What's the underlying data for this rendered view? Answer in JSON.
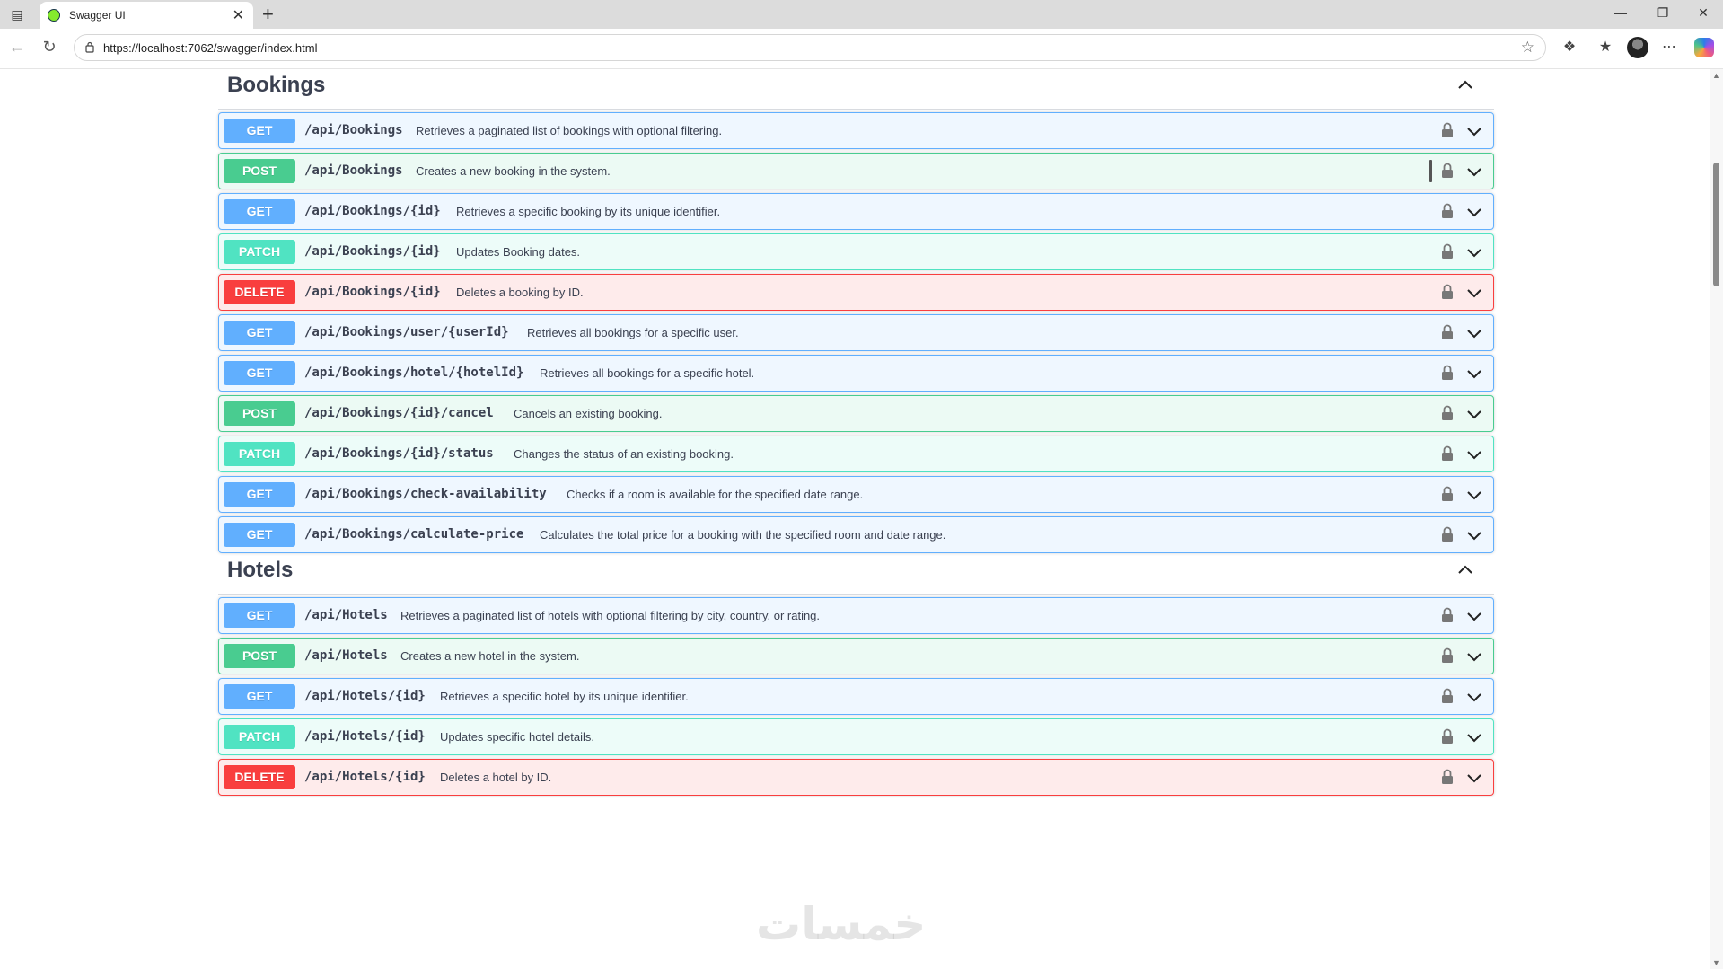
{
  "browser": {
    "tab_title": "Swagger UI",
    "url": "https://localhost:7062/swagger/index.html"
  },
  "sections": [
    {
      "title": "Bookings",
      "operations": [
        {
          "method": "GET",
          "path": "/api/Bookings",
          "summary": "Retrieves a paginated list of bookings with optional filtering."
        },
        {
          "method": "POST",
          "path": "/api/Bookings",
          "summary": "Creates a new booking in the system."
        },
        {
          "method": "GET",
          "path": "/api/Bookings/{id}",
          "summary": "Retrieves a specific booking by its unique identifier."
        },
        {
          "method": "PATCH",
          "path": "/api/Bookings/{id}",
          "summary": "Updates Booking dates."
        },
        {
          "method": "DELETE",
          "path": "/api/Bookings/{id}",
          "summary": "Deletes a booking by ID."
        },
        {
          "method": "GET",
          "path": "/api/Bookings/user/{userId}",
          "summary": "Retrieves all bookings for a specific user."
        },
        {
          "method": "GET",
          "path": "/api/Bookings/hotel/{hotelId}",
          "summary": "Retrieves all bookings for a specific hotel."
        },
        {
          "method": "POST",
          "path": "/api/Bookings/{id}/cancel",
          "summary": "Cancels an existing booking."
        },
        {
          "method": "PATCH",
          "path": "/api/Bookings/{id}/status",
          "summary": "Changes the status of an existing booking."
        },
        {
          "method": "GET",
          "path": "/api/Bookings/check-availability",
          "summary": "Checks if a room is available for the specified date range."
        },
        {
          "method": "GET",
          "path": "/api/Bookings/calculate-price",
          "summary": "Calculates the total price for a booking with the specified room and date range."
        }
      ]
    },
    {
      "title": "Hotels",
      "operations": [
        {
          "method": "GET",
          "path": "/api/Hotels",
          "summary": "Retrieves a paginated list of hotels with optional filtering by city, country, or rating."
        },
        {
          "method": "POST",
          "path": "/api/Hotels",
          "summary": "Creates a new hotel in the system."
        },
        {
          "method": "GET",
          "path": "/api/Hotels/{id}",
          "summary": "Retrieves a specific hotel by its unique identifier."
        },
        {
          "method": "PATCH",
          "path": "/api/Hotels/{id}",
          "summary": "Updates specific hotel details."
        },
        {
          "method": "DELETE",
          "path": "/api/Hotels/{id}",
          "summary": "Deletes a hotel by ID."
        }
      ]
    }
  ],
  "watermark": "خمسات",
  "colors": {
    "get": "#61affe",
    "post": "#49cc90",
    "patch": "#50e3c2",
    "delete": "#f93e3e",
    "text": "#3b4151"
  },
  "icons": {
    "operation_lock": "lock-icon",
    "operation_toggle": "chevron-down-icon",
    "section_toggle": "chevron-up-icon"
  }
}
